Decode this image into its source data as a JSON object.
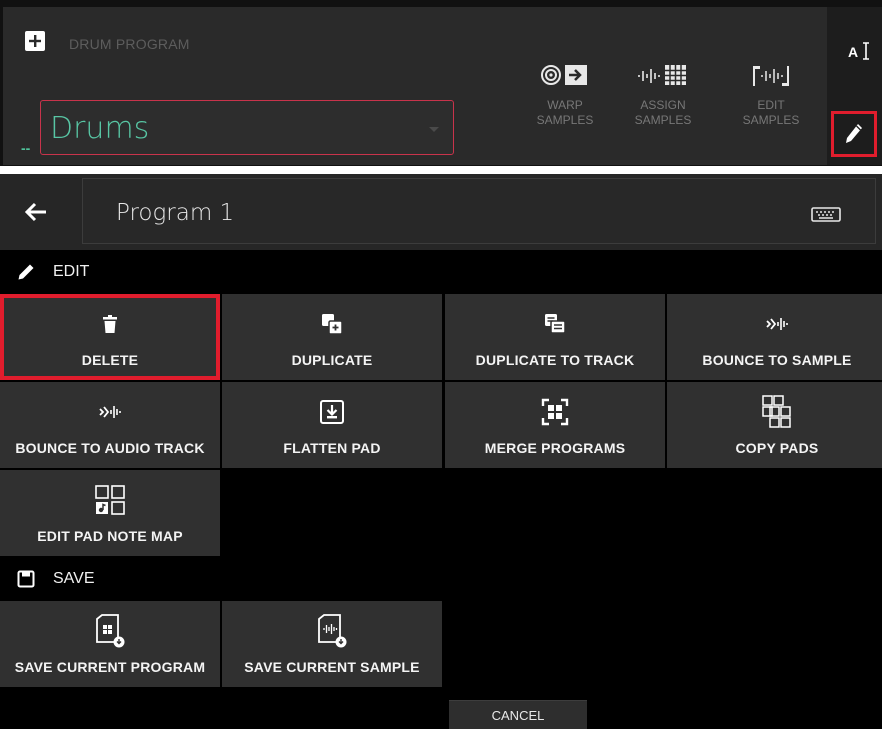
{
  "top_panel": {
    "program_type": "DRUM PROGRAM",
    "program_name": "Drums",
    "dash": "--",
    "tools": [
      {
        "label": "WARP\nSAMPLES",
        "icon": "warp-samples-icon"
      },
      {
        "label": "ASSIGN\nSAMPLES",
        "icon": "assign-samples-icon"
      },
      {
        "label": "EDIT\nSAMPLES",
        "icon": "edit-samples-icon"
      }
    ],
    "text_size_icon": "text-size-icon",
    "pencil_icon": "pencil-icon"
  },
  "header": {
    "name_value": "Program 1",
    "back_icon": "arrow-left-icon",
    "keyboard_icon": "keyboard-icon"
  },
  "edit_section": {
    "title": "EDIT",
    "items": [
      {
        "label": "DELETE",
        "icon": "trash-icon"
      },
      {
        "label": "DUPLICATE",
        "icon": "duplicate-icon"
      },
      {
        "label": "DUPLICATE TO TRACK",
        "icon": "duplicate-to-track-icon"
      },
      {
        "label": "BOUNCE TO SAMPLE",
        "icon": "bounce-icon"
      },
      {
        "label": "BOUNCE TO AUDIO TRACK",
        "icon": "bounce-icon"
      },
      {
        "label": "FLATTEN PAD",
        "icon": "flatten-icon"
      },
      {
        "label": "MERGE PROGRAMS",
        "icon": "merge-icon"
      },
      {
        "label": "COPY PADS",
        "icon": "copy-pads-icon"
      },
      {
        "label": "EDIT PAD NOTE MAP",
        "icon": "pad-note-map-icon"
      }
    ]
  },
  "save_section": {
    "title": "SAVE",
    "items": [
      {
        "label": "SAVE CURRENT PROGRAM",
        "icon": "save-program-icon"
      },
      {
        "label": "SAVE CURRENT SAMPLE",
        "icon": "save-sample-icon"
      }
    ]
  },
  "cancel_label": "CANCEL",
  "colors": {
    "highlight": "#e01d2d",
    "accent": "#58c6a4",
    "tile": "#303030"
  }
}
